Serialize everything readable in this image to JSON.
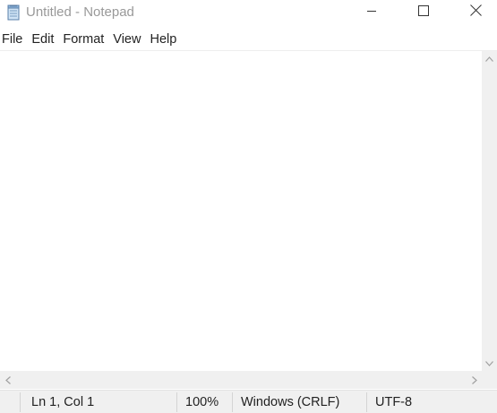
{
  "window": {
    "title": "Untitled - Notepad",
    "icon": "notepad-icon",
    "controls": {
      "minimize": "minimize-icon",
      "maximize": "maximize-icon",
      "close": "close-icon"
    }
  },
  "menu": {
    "items": [
      {
        "label": "File"
      },
      {
        "label": "Edit"
      },
      {
        "label": "Format"
      },
      {
        "label": "View"
      },
      {
        "label": "Help"
      }
    ]
  },
  "editor": {
    "value": ""
  },
  "statusbar": {
    "position": "Ln 1, Col 1",
    "zoom": "100%",
    "line_ending": "Windows (CRLF)",
    "encoding": "UTF-8"
  },
  "colors": {
    "title_text": "#999999",
    "menu_text": "#222222",
    "chrome_background": "#f0f0f0",
    "editor_background": "#ffffff"
  }
}
